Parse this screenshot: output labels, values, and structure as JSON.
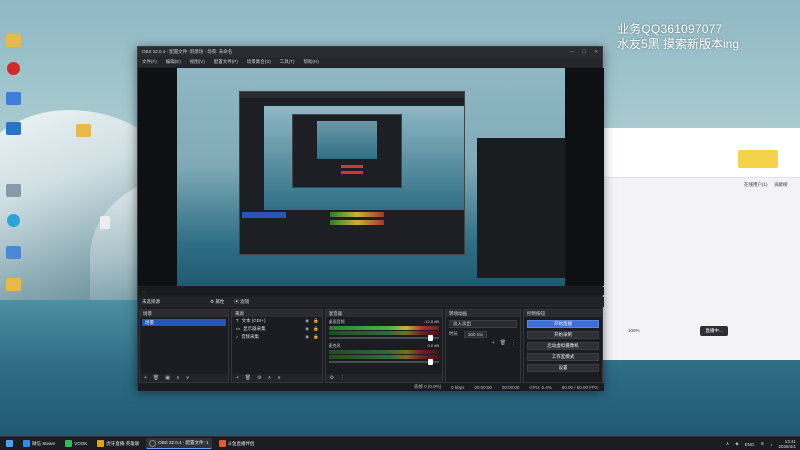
{
  "watermark": {
    "line1": "业务QQ361097077",
    "line2": "水友5黑 摸索新版本ing"
  },
  "desktop_icons": [
    {
      "label": "",
      "icon": "folder-icon",
      "color": "#e8b84a"
    },
    {
      "label": "",
      "icon": "app-red-icon",
      "color": "#d22a2a"
    },
    {
      "label": "",
      "icon": "app-blue-icon",
      "color": "#3d7fd6"
    },
    {
      "label": "",
      "icon": "app-blue2-icon",
      "color": "#2a74c6"
    },
    {
      "label": "",
      "icon": "folder-icon",
      "color": "#e8b84a"
    },
    {
      "label": "",
      "icon": "file-icon",
      "color": "#eeeeee"
    },
    {
      "label": "",
      "icon": "app-grey-icon",
      "color": "#8899aa"
    },
    {
      "label": "",
      "icon": "edge-icon",
      "color": "#29a3d8"
    },
    {
      "label": "",
      "icon": "app-monitor-icon",
      "color": "#4a8ad4"
    },
    {
      "label": "",
      "icon": "folder-icon",
      "color": "#e8b84a"
    }
  ],
  "obs": {
    "title": "OBS 32.0.4 - 配置文件: 新建场 - 场景: 未命名",
    "menu": [
      "文件(F)",
      "编辑(E)",
      "视图(V)",
      "配置文件(P)",
      "场景集合(S)",
      "工具(T)",
      "帮助(H)"
    ],
    "scene_bar_label": "未选择源",
    "source_bar": {
      "properties": "属性",
      "filters": "滤镜"
    },
    "docks": {
      "scenes": {
        "title": "场景",
        "selected": "场景"
      },
      "sources": {
        "title": "来源",
        "items": [
          "文本 (GDI+)",
          "显示器采集",
          "音频采集"
        ]
      },
      "mixer": {
        "title": "混音器",
        "channels": [
          {
            "name": "桌面音频",
            "db": "-12.8 dB"
          },
          {
            "name": "麦克风",
            "db": "0.0 dB"
          }
        ]
      },
      "transitions": {
        "title": "转场动画",
        "type": "淡入淡出",
        "duration_label": "时长",
        "duration_value": "300 ms"
      },
      "controls": {
        "title": "控制按钮",
        "buttons": [
          "开始直播",
          "开始录制",
          "启动虚拟摄像机",
          "工作室模式",
          "设置"
        ]
      }
    },
    "status": {
      "frames": "丢帧 0 (0.0%)",
      "bitrate": "0 kbps",
      "stream_time": "00:00:00",
      "rec_time": "00:00:00",
      "cpu": "CPU: 0.4%",
      "fps": "60.00 / 60.00 FPS"
    }
  },
  "bgapp": {
    "right_tabs": [
      "在线用户(1)",
      "贡献榜"
    ],
    "primary_btn": "直播中...",
    "zoom": "100%"
  },
  "taskbar": {
    "items": [
      {
        "label": "微信 Steam",
        "color": "#2d8cf0"
      },
      {
        "label": "VOOK",
        "color": "#2fbf55"
      },
      {
        "label": "虎牙直播-英雄联",
        "color": "#e3a017"
      },
      {
        "label": "OBS 32.0.4 - 配置文件: 1",
        "color": "#303030",
        "active": true
      },
      {
        "label": "斗鱼直播伴侣",
        "color": "#e55a2b"
      }
    ],
    "tray": {
      "lang": "ENG",
      "time": "13:41",
      "date": "2026/4/1"
    }
  },
  "colors": {
    "accent": "#3e6fd8",
    "obs_bg": "#1e1f24",
    "live_red": "#e0473a",
    "live_green": "#39c27b"
  }
}
